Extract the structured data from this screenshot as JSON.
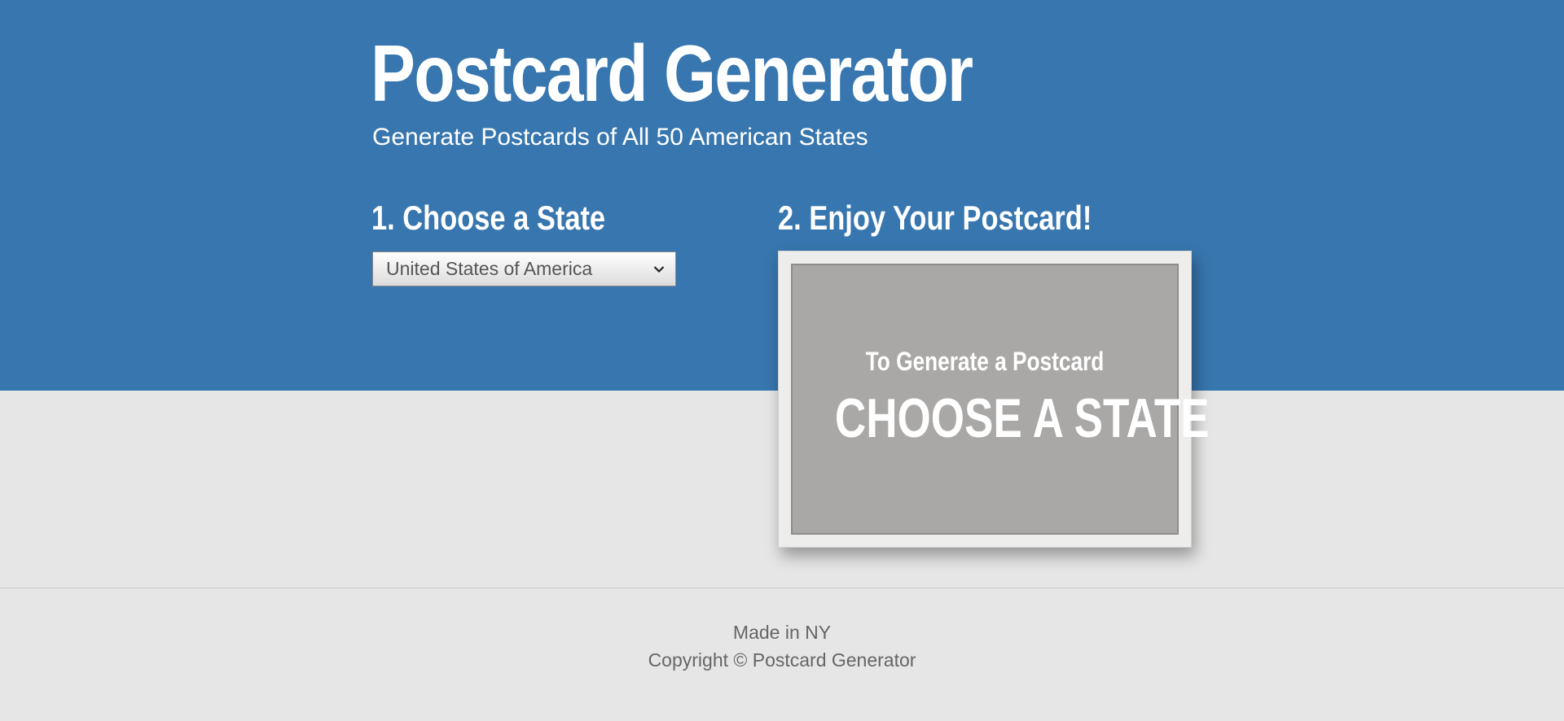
{
  "header": {
    "title": "Postcard Generator",
    "subtitle": "Generate Postcards of All 50 American States"
  },
  "steps": {
    "choose_heading": "1. Choose a State",
    "enjoy_heading": "2. Enjoy Your Postcard!"
  },
  "state_select": {
    "selected_value": "United States of America"
  },
  "postcard": {
    "small_text": "To Generate a Postcard",
    "big_text": "CHOOSE A STATE"
  },
  "footer": {
    "made_in": "Made in NY",
    "copyright": "Copyright © Postcard Generator"
  },
  "colors": {
    "hero_background": "#3776ae",
    "page_background": "#e6e6e6",
    "postcard_gray": "#a9a8a6"
  },
  "icons": {
    "select_arrow": "chevron-down-icon"
  }
}
